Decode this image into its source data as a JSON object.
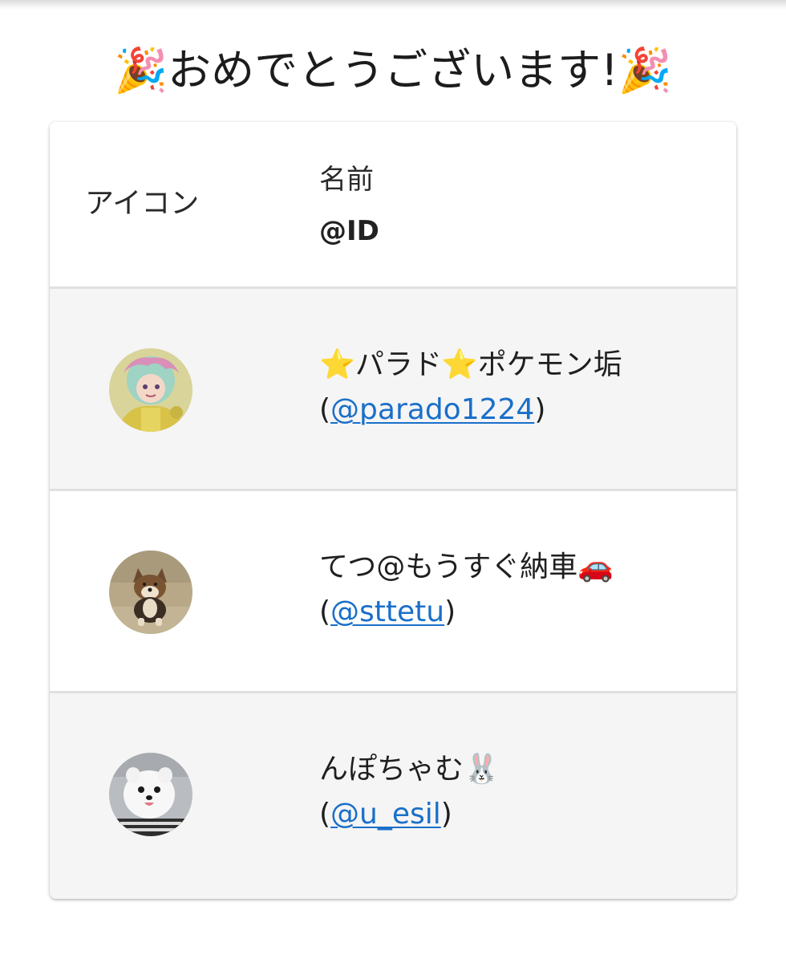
{
  "title": "🎉おめでとうございます!🎉",
  "table": {
    "header": {
      "icon_col": "アイコン",
      "name_col": "名前",
      "id_col": "@ID"
    },
    "rows": [
      {
        "name": "⭐パラド⭐ポケモン垢",
        "id_open": "(",
        "id": "@parado1224",
        "id_close": ")",
        "avatar": "anime-character-avatar"
      },
      {
        "name": "てつ@もうすぐ納車🚗",
        "id_open": "(",
        "id": "@sttetu",
        "id_close": ")",
        "avatar": "shiba-dog-avatar"
      },
      {
        "name": "んぽちゃむ🐰",
        "id_open": "(",
        "id": "@u_esil",
        "id_close": ")",
        "avatar": "white-pomeranian-avatar"
      }
    ]
  },
  "colors": {
    "link": "#1a6fc9",
    "row_alt": "#f5f5f5",
    "divider": "#e0e0e0"
  }
}
